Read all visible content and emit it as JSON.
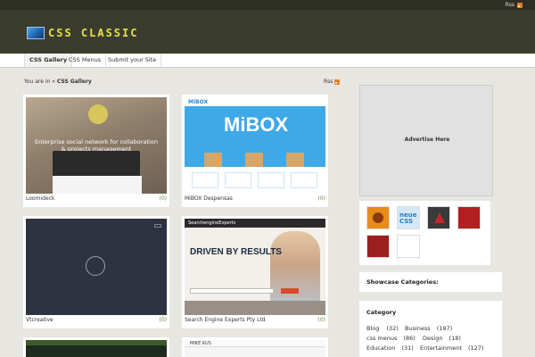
{
  "topbar": {
    "rss_label": "Rss"
  },
  "header": {
    "logo_text": "CSS CLASSIC"
  },
  "nav": [
    {
      "label": "CSS Gallery"
    },
    {
      "label": "CSS Menus"
    },
    {
      "label": "Submit your Site"
    }
  ],
  "breadcrumb": {
    "prefix": "You are in »",
    "current": "CSS Gallery"
  },
  "content_rss": "Rss",
  "gallery": [
    {
      "title": "Loomideck",
      "count": "(0)",
      "tagline": "Enterprise social network for collaboration & projects management"
    },
    {
      "title": "MiBOX Despensas",
      "count": "(0)",
      "brand": "MiBOX",
      "hero": "MiBOX"
    },
    {
      "title": "Vtcreative",
      "count": "(0)"
    },
    {
      "title": "Search Engine Experts Pty Ltd",
      "count": "(0)",
      "brand": "SearchengineExperts",
      "headline": "DRIVEN BY RESULTS"
    },
    {
      "title": "",
      "count": ""
    },
    {
      "title": "",
      "count": "",
      "brand": "MIKE KUS"
    }
  ],
  "sidebar": {
    "advert": "Advertise Here",
    "sponsors": [
      {
        "color": "#e98b1a"
      },
      {
        "color": "#d6e7f4",
        "label": "neue CSS"
      },
      {
        "color": "#3a3a3a"
      },
      {
        "color": "#b32020"
      },
      {
        "color": "#9a1f1f"
      },
      {
        "color": "#ffffff"
      }
    ],
    "showcase_title": "Showcase Categories:",
    "category_title": "Category",
    "categories": [
      {
        "name": "Blog",
        "count": "(32)"
      },
      {
        "name": "Business",
        "count": "(197)"
      },
      {
        "name": "css menus",
        "count": "(86)"
      },
      {
        "name": "Design",
        "count": "(18)"
      },
      {
        "name": "Education",
        "count": "(31)"
      },
      {
        "name": "Entertainment",
        "count": "(127)"
      }
    ]
  },
  "colors": {
    "header_bg": "#3a3d2e",
    "logo": "#e8e04a",
    "rss": "#f07c1c",
    "count": "#6a8a2e"
  }
}
